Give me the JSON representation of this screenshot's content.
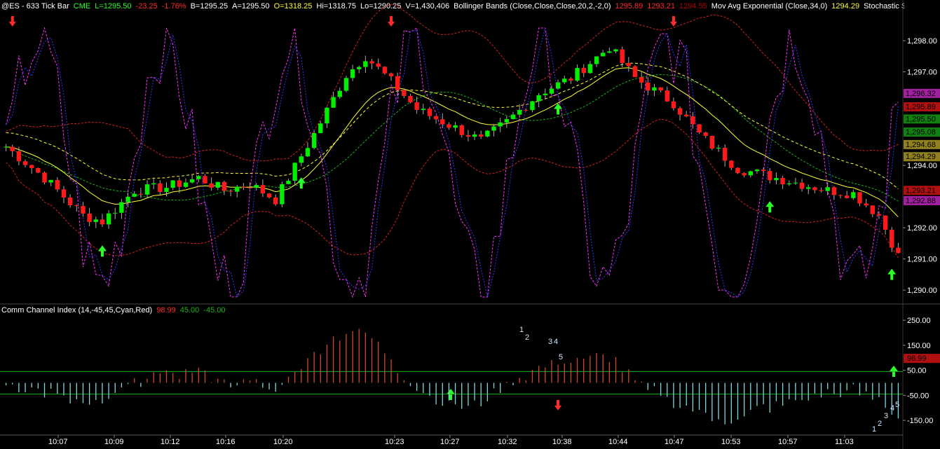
{
  "header": {
    "symbol": "@ES - 633 Tick Bar",
    "exchange": "CME",
    "last": "L=1295.50",
    "change": "-23.25",
    "change_pct": "-1.76%",
    "bid": "B=1295.25",
    "ask": "A=1295.50",
    "open": "O=1318.25",
    "high": "Hi=1318.75",
    "low": "Lo=1290.25",
    "volume": "V=1,430,406",
    "bb_label": "Bollinger Bands (Close,Close,Close,20,2,-2,0)",
    "bb_upper": "1295.89",
    "bb_lower": "1293.21",
    "bb_mid": "1294.55",
    "ema_label": "Mov Avg Exponential (Close,34,0)",
    "ema_value": "1294.29",
    "stoch_label": "Stochastic Sl"
  },
  "subpanel": {
    "label": "Comm Channel Index (14,-45,45,Cyan,Red)",
    "value": "98.99",
    "upper": "45.00",
    "lower": "-45.00"
  },
  "colors": {
    "up_candle": "#00ee00",
    "down_candle": "#ff1a1a",
    "ema": "#ffff33",
    "bb": "#d02020",
    "stoch_k": "#ff33ff",
    "stoch_d": "#3333ff",
    "cci_pos": "#d04a2a",
    "cci_neg": "#7fd8e0",
    "level_line": "#18b318"
  },
  "price_tags": [
    {
      "text": "1,296.32",
      "bg": "#a020a0"
    },
    {
      "text": "1,295.89",
      "bg": "#b01010"
    },
    {
      "text": "1,295.50",
      "bg": "#108010"
    },
    {
      "text": "1,295.08",
      "bg": "#108010"
    },
    {
      "text": "1,294.68",
      "bg": "#908020"
    },
    {
      "text": "1,294.29",
      "bg": "#908020"
    },
    {
      "text": "1,293.21",
      "bg": "#b01010"
    },
    {
      "text": "1,292.88",
      "bg": "#a020a0"
    }
  ],
  "cci_tag": {
    "text": "98.99",
    "bg": "#b01010"
  },
  "cci_labels": [
    "1",
    "2",
    "3",
    "4",
    "5"
  ],
  "chart_data": {
    "type": "bar",
    "price_axis": {
      "ticks": [
        "1,298.00",
        "1,297.00",
        "1,294.00",
        "1,292.00",
        "1,291.00",
        "1,290.00"
      ],
      "values": [
        1298,
        1297,
        1294,
        1292,
        1291,
        1290
      ],
      "range": [
        1289.6,
        1298.9
      ]
    },
    "cci_axis": {
      "ticks": [
        "250.00",
        "150.00",
        "50.00",
        "-50.00",
        "-150.00"
      ],
      "values": [
        250,
        150,
        50,
        -50,
        -150
      ],
      "range": [
        -200,
        270
      ]
    },
    "time_axis": [
      "10:07",
      "10:09",
      "10:12",
      "10:16",
      "10:20",
      "10:23",
      "10:27",
      "10:32",
      "10:38",
      "10:44",
      "10:47",
      "10:53",
      "10:57",
      "11:03"
    ]
  }
}
